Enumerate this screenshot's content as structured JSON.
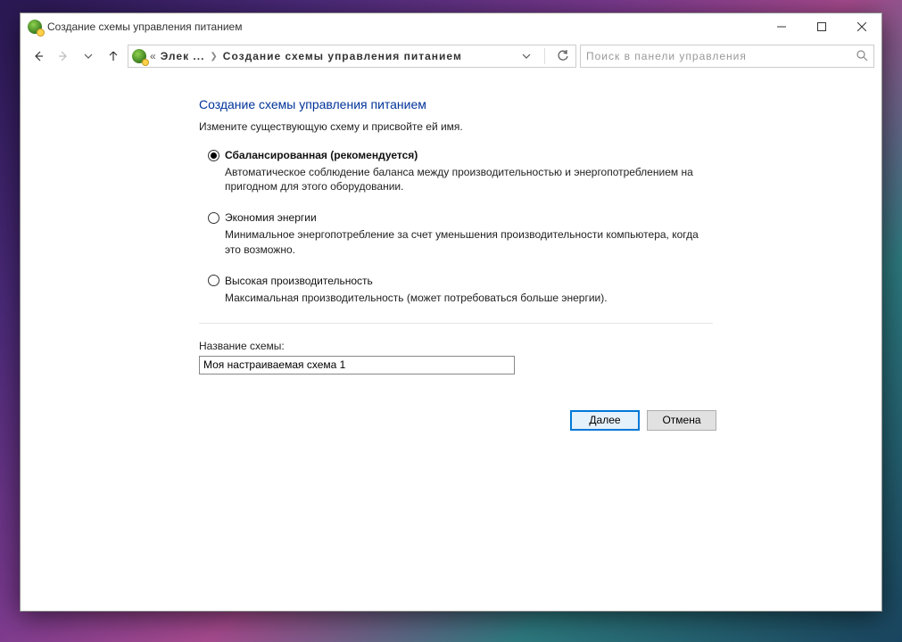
{
  "window": {
    "title": "Создание схемы управления питанием"
  },
  "breadcrumb": {
    "root_prefix": "«",
    "root": "Элек ...",
    "current": "Создание схемы управления питанием"
  },
  "search": {
    "placeholder": "Поиск в панели управления"
  },
  "page": {
    "heading": "Создание схемы управления питанием",
    "subtitle": "Измените существующую схему и присвойте ей имя."
  },
  "plans": [
    {
      "title": "Сбалансированная (рекомендуется)",
      "desc": "Автоматическое соблюдение баланса между производительностью и энергопотреблением на пригодном для этого оборудовании.",
      "checked": true,
      "bold": true
    },
    {
      "title": "Экономия энергии",
      "desc": "Минимальное энергопотребление за счет уменьшения производительности компьютера, когда это возможно.",
      "checked": false,
      "bold": false
    },
    {
      "title": "Высокая производительность",
      "desc": "Максимальная производительность (может потребоваться больше энергии).",
      "checked": false,
      "bold": false
    }
  ],
  "name_field": {
    "label": "Название схемы:",
    "value": "Моя настраиваемая схема 1"
  },
  "buttons": {
    "next": "Далее",
    "cancel": "Отмена"
  }
}
